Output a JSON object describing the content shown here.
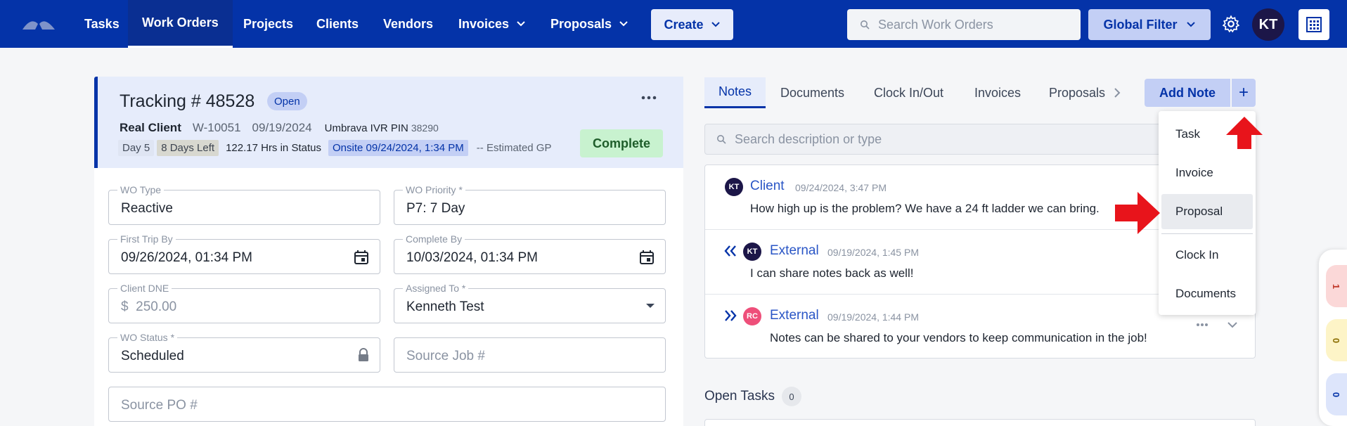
{
  "nav": {
    "items": [
      {
        "label": "Tasks",
        "dropdown": false
      },
      {
        "label": "Work Orders",
        "dropdown": false,
        "active": true
      },
      {
        "label": "Projects",
        "dropdown": false
      },
      {
        "label": "Clients",
        "dropdown": false
      },
      {
        "label": "Vendors",
        "dropdown": false
      },
      {
        "label": "Invoices",
        "dropdown": true
      },
      {
        "label": "Proposals",
        "dropdown": true
      }
    ],
    "create_label": "Create",
    "search_placeholder": "Search Work Orders",
    "global_filter_label": "Global Filter",
    "user_initials": "KT"
  },
  "work_order": {
    "tracking_title": "Tracking # 48528",
    "status_badge": "Open",
    "client_name": "Real Client",
    "wo_number": "W-10051",
    "date": "09/19/2024",
    "ivr_label": "Umbrava IVR PIN",
    "ivr_pin": "38290",
    "day_chip": "Day 5",
    "days_left_chip": "8 Days Left",
    "hrs_in_status": "122.17 Hrs in Status",
    "onsite_chip": "Onsite 09/24/2024, 1:34 PM",
    "estimated_gp": "-- Estimated GP",
    "complete_label": "Complete"
  },
  "form": {
    "wo_type": {
      "label": "WO Type",
      "value": "Reactive"
    },
    "wo_priority": {
      "label": "WO Priority *",
      "value": "P7: 7 Day"
    },
    "first_trip_by": {
      "label": "First Trip By",
      "value": "09/26/2024, 01:34 PM"
    },
    "complete_by": {
      "label": "Complete By",
      "value": "10/03/2024, 01:34 PM"
    },
    "client_dne": {
      "label": "Client DNE",
      "prefix": "$",
      "placeholder": "250.00"
    },
    "assigned_to": {
      "label": "Assigned To *",
      "value": "Kenneth Test"
    },
    "wo_status": {
      "label": "WO Status *",
      "value": "Scheduled"
    },
    "source_job": {
      "placeholder": "Source Job #"
    },
    "source_po": {
      "placeholder": "Source PO #"
    }
  },
  "right_panel": {
    "tabs": [
      "Notes",
      "Documents",
      "Clock In/Out",
      "Invoices",
      "Proposals"
    ],
    "add_note_label": "Add Note",
    "plus_label": "+",
    "note_search_placeholder": "Search description or type",
    "notes": [
      {
        "initials": "KT",
        "author": "Client",
        "timestamp": "09/24/2024, 3:47 PM",
        "body": "How high up is the problem? We have a 24 ft ladder we can bring."
      },
      {
        "initials": "KT",
        "author": "External",
        "timestamp": "09/19/2024, 1:45 PM",
        "body": "I can share notes back as well!",
        "direction": "incoming"
      },
      {
        "initials": "RC",
        "author": "External",
        "timestamp": "09/19/2024, 1:44 PM",
        "body": "Notes can be shared to your vendors to keep communication in the job!",
        "direction": "outgoing"
      }
    ],
    "open_tasks_label": "Open Tasks",
    "open_tasks_count": "0"
  },
  "add_menu": {
    "items": [
      "Task",
      "Invoice",
      "Proposal",
      "Clock In",
      "Documents"
    ],
    "highlighted": "Proposal"
  },
  "side_strip": {
    "counts": [
      "1",
      "0",
      "0"
    ]
  },
  "colors": {
    "brand": "#0433a8",
    "annotation_arrow": "#e8141b"
  }
}
